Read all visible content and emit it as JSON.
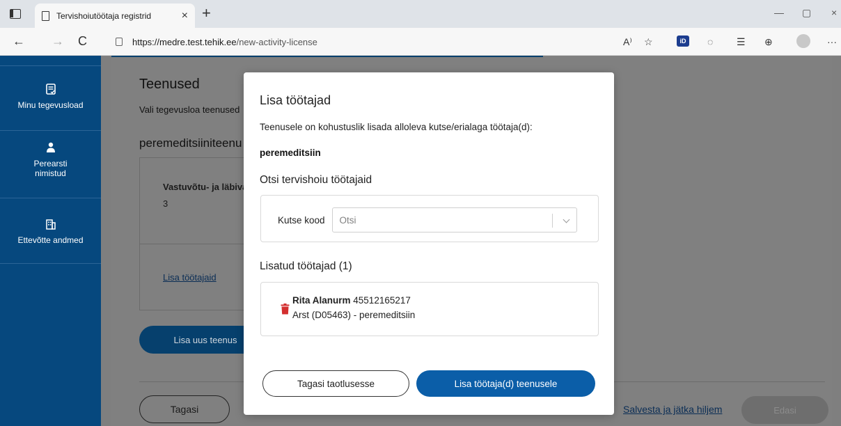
{
  "browser": {
    "tab_title": "Tervishoiutöötaja registrid",
    "tab_close": "×",
    "new_tab": "+",
    "url_host": "https://medre.test.tehik.ee",
    "url_path": "/new-activity-license",
    "back": "←",
    "forward": "→",
    "reload": "C",
    "minimize": "—",
    "restore": "▢",
    "close": "×",
    "read_aloud": "A⁾",
    "favorite": "☆",
    "id_ext": "iD",
    "menu": "···"
  },
  "sidebar": {
    "items": [
      {
        "label": "Minu tegevusload",
        "icon": "document-check-icon"
      },
      {
        "label": "Perearsti nimistud",
        "icon": "doctor-icon"
      },
      {
        "label": "Ettevõtte andmed",
        "icon": "building-icon"
      }
    ]
  },
  "content": {
    "title": "Teenused",
    "subtitle": "Vali tegevusloa teenused",
    "section": "peremeditsiiniteenu",
    "card_label": "Vastuvõtu- ja läbiva",
    "card_value": "3",
    "add_workers_link": "Lisa töötajaid",
    "add_service_button": "Lisa uus teenus",
    "back_button": "Tagasi",
    "save_link": "Salvesta ja jätka hiljem",
    "next_button": "Edasi"
  },
  "modal": {
    "title": "Lisa töötajad",
    "info": "Teenusele on kohustuslik lisada alloleva kutse/erialaga töötaja(d):",
    "specialty": "peremeditsiin",
    "search_heading": "Otsi tervishoiu töötajaid",
    "code_label": "Kutse kood",
    "search_placeholder": "Otsi",
    "added_heading": "Lisatud töötajad (1)",
    "employee": {
      "name": "Rita Alanurm",
      "id_code": "45512165217",
      "role": "Arst (D05463) - peremeditsiin"
    },
    "cancel_button": "Tagasi taotlusesse",
    "confirm_button": "Lisa töötaja(d) teenusele"
  },
  "colors": {
    "sidebar": "#06487e",
    "primary": "#0b5ea8",
    "trash": "#d32f2f"
  }
}
